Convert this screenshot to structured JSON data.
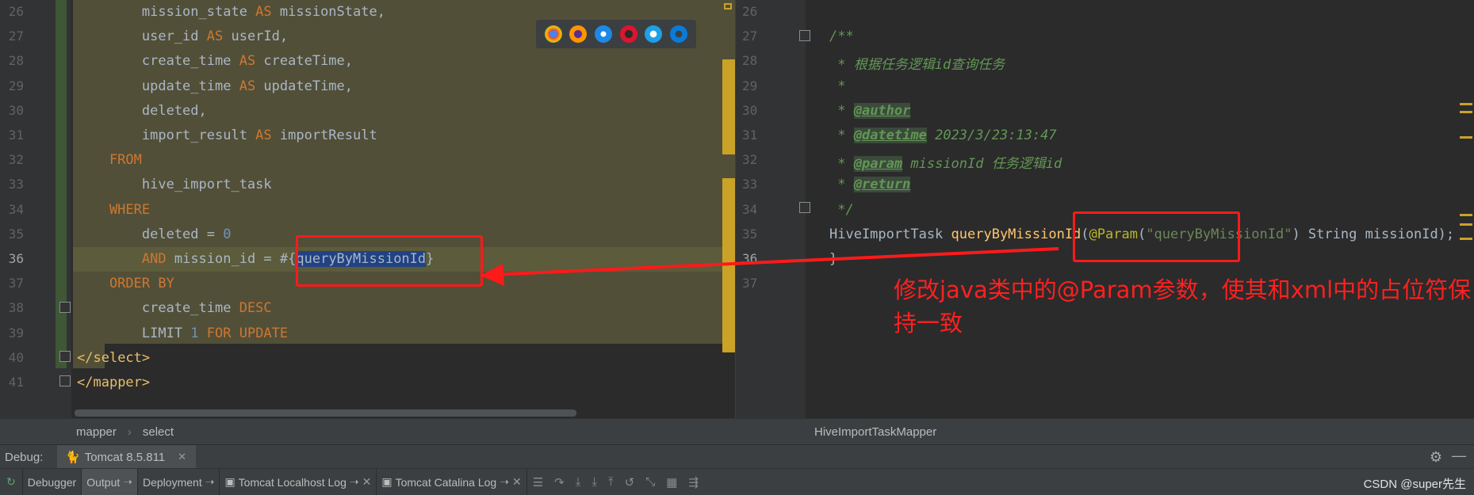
{
  "left_editor": {
    "line_numbers": [
      "26",
      "27",
      "28",
      "29",
      "30",
      "31",
      "32",
      "33",
      "34",
      "35",
      "36",
      "37",
      "38",
      "39",
      "40",
      "41"
    ],
    "lines": [
      [
        {
          "t": "        mission_state ",
          "c": ""
        },
        {
          "t": "AS",
          "c": "kw"
        },
        {
          "t": " missionState,",
          "c": ""
        }
      ],
      [
        {
          "t": "        user_id ",
          "c": ""
        },
        {
          "t": "AS",
          "c": "kw"
        },
        {
          "t": " userId,",
          "c": ""
        }
      ],
      [
        {
          "t": "        create_time ",
          "c": ""
        },
        {
          "t": "AS",
          "c": "kw"
        },
        {
          "t": " createTime,",
          "c": ""
        }
      ],
      [
        {
          "t": "        update_time ",
          "c": ""
        },
        {
          "t": "AS",
          "c": "kw"
        },
        {
          "t": " updateTime,",
          "c": ""
        }
      ],
      [
        {
          "t": "        deleted,",
          "c": ""
        }
      ],
      [
        {
          "t": "        import_result ",
          "c": ""
        },
        {
          "t": "AS",
          "c": "kw"
        },
        {
          "t": " importResult",
          "c": ""
        }
      ],
      [
        {
          "t": "    FROM",
          "c": "kw"
        }
      ],
      [
        {
          "t": "        hive_import_task",
          "c": ""
        }
      ],
      [
        {
          "t": "    WHERE",
          "c": "kw"
        }
      ],
      [
        {
          "t": "        deleted = ",
          "c": ""
        },
        {
          "t": "0",
          "c": "num"
        }
      ],
      [
        {
          "t": "        ",
          "c": ""
        },
        {
          "t": "AND",
          "c": "kw"
        },
        {
          "t": " mission_id = #{",
          "c": ""
        },
        {
          "t": "queryByMissionId",
          "c": "sel"
        },
        {
          "t": "}",
          "c": ""
        }
      ],
      [
        {
          "t": "    ORDER BY",
          "c": "kw"
        }
      ],
      [
        {
          "t": "        create_time ",
          "c": ""
        },
        {
          "t": "DESC",
          "c": "kw"
        }
      ],
      [
        {
          "t": "        LIMIT ",
          "c": ""
        },
        {
          "t": "1",
          "c": "num"
        },
        {
          "t": " FOR UPDATE",
          "c": "kw"
        }
      ],
      [
        {
          "t": "</",
          "c": "tag"
        },
        {
          "t": "select",
          "c": "tag"
        },
        {
          "t": ">",
          "c": "tag"
        }
      ],
      [
        {
          "t": "</",
          "c": "tag"
        },
        {
          "t": "mapper",
          "c": "tag"
        },
        {
          "t": ">",
          "c": "tag"
        }
      ]
    ]
  },
  "right_editor": {
    "line_numbers": [
      "26",
      "27",
      "28",
      "29",
      "30",
      "31",
      "32",
      "33",
      "34",
      "35",
      "36",
      "37"
    ],
    "lines": [
      [],
      [
        {
          "t": "/**",
          "c": "cm"
        }
      ],
      [
        {
          "t": " * 根据任务逻辑id查询任务",
          "c": "cm"
        }
      ],
      [
        {
          "t": " *",
          "c": "cm"
        }
      ],
      [
        {
          "t": " * ",
          "c": "cm"
        },
        {
          "t": "@author",
          "c": "doctag"
        }
      ],
      [
        {
          "t": " * ",
          "c": "cm"
        },
        {
          "t": "@datetime",
          "c": "doctag"
        },
        {
          "t": " 2023/3/23:13:47",
          "c": "cm"
        }
      ],
      [
        {
          "t": " * ",
          "c": "cm"
        },
        {
          "t": "@param",
          "c": "doctag"
        },
        {
          "t": " missionId 任务逻辑id",
          "c": "cm"
        }
      ],
      [
        {
          "t": " * ",
          "c": "cm"
        },
        {
          "t": "@return",
          "c": "doctag"
        }
      ],
      [
        {
          "t": " */",
          "c": "cm"
        }
      ],
      [
        {
          "t": "HiveImportTask ",
          "c": ""
        },
        {
          "t": "queryByMissionId",
          "c": "fn"
        },
        {
          "t": "(",
          "c": ""
        },
        {
          "t": "@Param",
          "c": "ann"
        },
        {
          "t": "(",
          "c": ""
        },
        {
          "t": "\"queryByMissionId\"",
          "c": "str"
        },
        {
          "t": ") String missionId);",
          "c": ""
        }
      ],
      [
        {
          "t": "}",
          "c": ""
        }
      ],
      []
    ]
  },
  "annotation": "修改java类中的@Param参数，使其和xml中的占位符保持一致",
  "breadcrumb": {
    "items": [
      "mapper",
      "select"
    ],
    "right": "HiveImportTaskMapper"
  },
  "debug": {
    "label": "Debug:",
    "run_tab": "Tomcat 8.5.811"
  },
  "toolbar": {
    "tabs": [
      "Debugger",
      "Output",
      "Deployment",
      "Tomcat Localhost Log",
      "Tomcat Catalina Log"
    ],
    "active": "Output"
  },
  "watermark": "CSDN @super先生",
  "colors": {
    "annotation_red": "#ff1a1a",
    "highlight_block": "#524f38",
    "selection": "#214283"
  }
}
